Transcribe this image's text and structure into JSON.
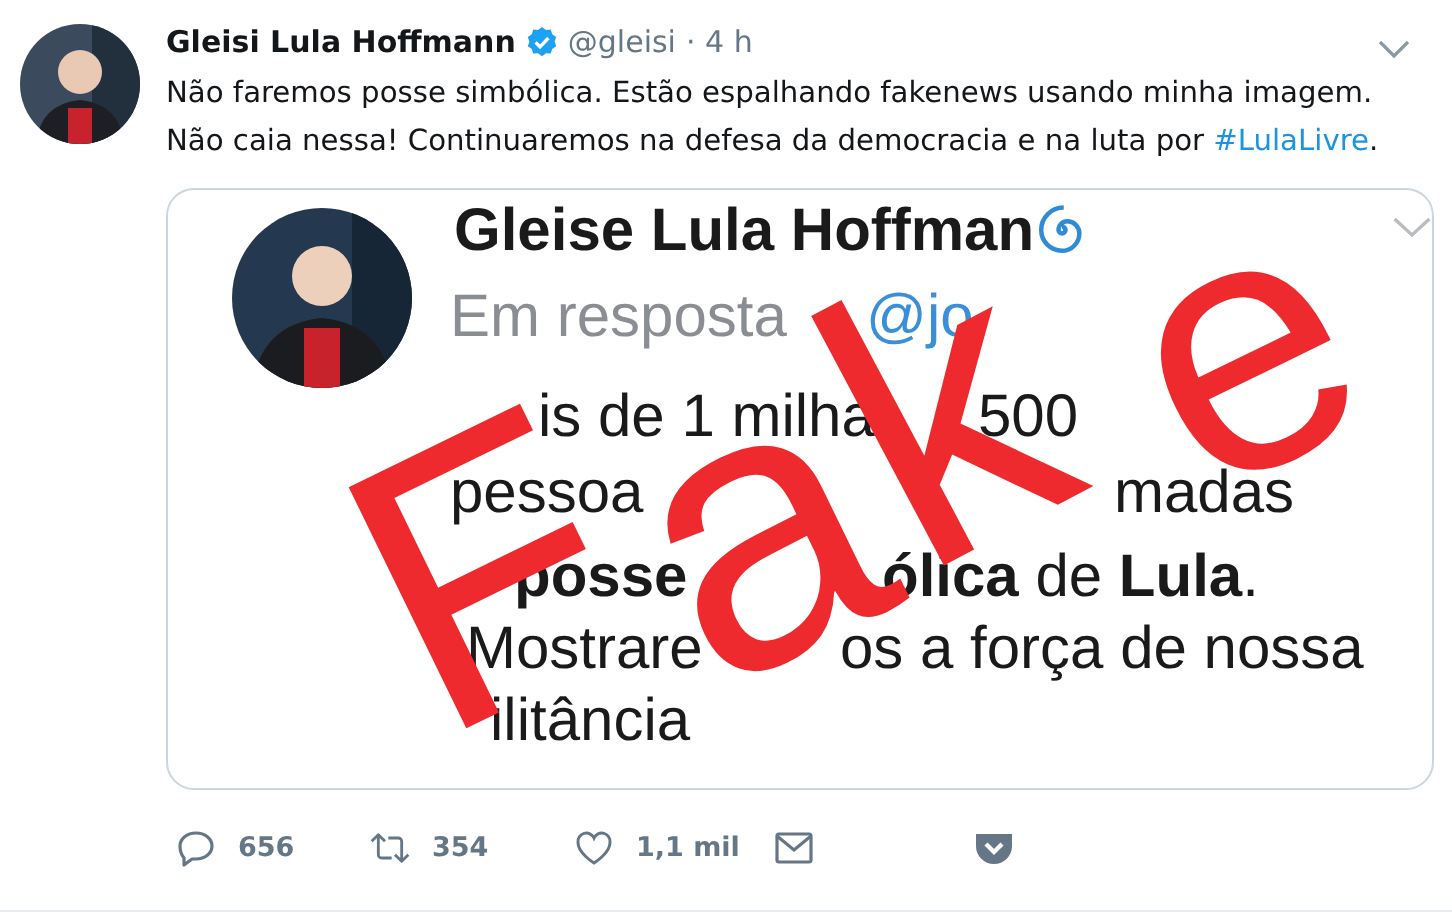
{
  "tweet": {
    "author": "Gleisi Lula Hoffmann",
    "verified": true,
    "handle": "@gleisi",
    "time": "· 4 h",
    "lines": [
      "Não faremos posse simbólica. Estão espalhando fakenews usando minha imagem.",
      "Não caia nessa! Continuaremos na defesa da democracia e na luta por "
    ],
    "hashtag": "#LulaLivre",
    "text_end": ".",
    "attached_image": {
      "author": "Gleise Lula Hoffman",
      "reply_label": "Em resposta",
      "reply_handle_parts": [
        "@jo"
      ],
      "lines": [
        [
          "is de 1 milha",
          "500"
        ],
        [
          "pessoa",
          "madas"
        ],
        [
          "**posse**",
          "**ólica** de **Lula**."
        ],
        [
          "Mostrare",
          "os a força de nossa"
        ],
        [
          "ilitância"
        ]
      ],
      "stamp": "Fake"
    },
    "actions": [
      {
        "kind": "reply",
        "count": "656"
      },
      {
        "kind": "retweet",
        "count": "354"
      },
      {
        "kind": "like",
        "count": "1,1 mil"
      },
      {
        "kind": "message"
      },
      {
        "kind": "pocket"
      }
    ]
  }
}
